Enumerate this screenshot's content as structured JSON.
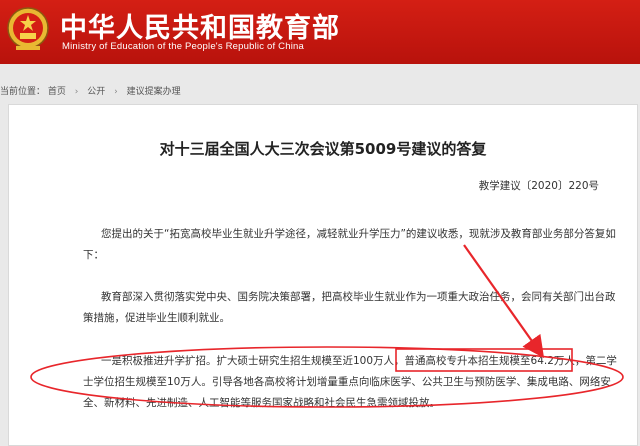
{
  "header": {
    "title": "中华人民共和国教育部",
    "subtitle": "Ministry of Education of the People's Republic of China"
  },
  "breadcrumb": {
    "prefix": "当前位置：",
    "items": [
      "首页",
      "公开",
      "建议提案办理"
    ]
  },
  "document": {
    "title": "对十三届全国人大三次会议第5009号建议的答复",
    "number": "教学建议〔2020〕220号",
    "para1": "您提出的关于“拓宽高校毕业生就业升学途径，减轻就业升学压力”的建议收悉，现就涉及教育部业务部分答复如下：",
    "para2": "教育部深入贯彻落实党中央、国务院决策部署，把高校毕业生就业作为一项重大政治任务，会同有关部门出台政策措施，促进毕业生顺利就业。",
    "para3_before": "一是积极推进升学扩招。扩大硕士研究生招生规模至近100万人，",
    "para3_highlight": "普通高校专升本招生规模至64.2万人，",
    "para3_after": "第二学士学位招生规模至10万人。引导各地各高校将计划增量重点向临床医学、公共卫生与预防医学、集成电路、网络安全、新材料、先进制造、人工智能等服务国家战略和社会民生急需领域投放。"
  },
  "colors": {
    "header_red": "#c8170f",
    "annotation_red": "#e8262b"
  }
}
